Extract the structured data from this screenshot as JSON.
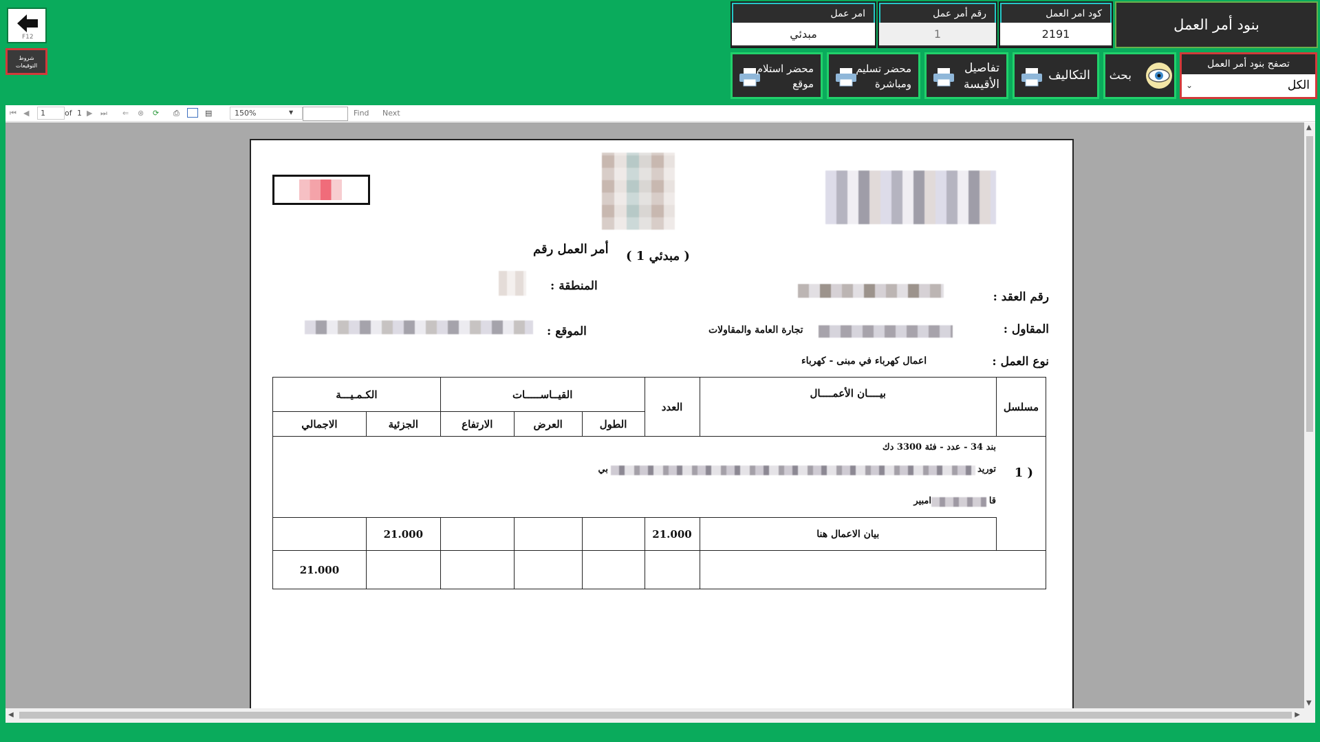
{
  "header": {
    "title": "بنود أمر العمل",
    "fields": [
      {
        "label": "كود امر العمل",
        "value": "2191"
      },
      {
        "label": "رقم أمر عمل",
        "value": "1"
      },
      {
        "label": "امر عمل",
        "value": "مبدئي"
      }
    ],
    "browse": {
      "label": "تصفح بنود أمر العمل",
      "value": "الكل"
    }
  },
  "left": {
    "back_hint": "F12",
    "signatures": "شروط التوقيعات"
  },
  "toolbar": {
    "search": "بحث",
    "costs": "التكاليف",
    "measure_1": "تفاصيل",
    "measure_2": "الأقيسة",
    "handover_1": "محضر تسليم",
    "handover_2": "ومباشرة",
    "receipt_1": "محضر استلام",
    "receipt_2": "موقع"
  },
  "viewer": {
    "page": "1",
    "of": "of",
    "total": "1",
    "zoom": "150%",
    "find": "Find",
    "next": "Next"
  },
  "report": {
    "heading": "أمر العمل رقم",
    "heading_value": "( مبدئي 1 )",
    "contract_label": "رقم العقد :",
    "region_label": "المنطقة :",
    "contractor_label": "المقاول :",
    "contractor_value": "تجارة العامة والمقاولات",
    "site_label": "الموقع :",
    "work_type_label": "نوع العمل :",
    "work_type_value": "اعمال كهرباء في مبنى - كهرباء",
    "columns": {
      "serial": "مسلسل",
      "description": "بيــــان الأعمــــال",
      "count": "العدد",
      "measurements": "القيــاســـــات",
      "quantity": "الكـمـيـــة",
      "length": "الطول",
      "width": "العرض",
      "height": "الارتفاع",
      "partial": "الجزئية",
      "total": "الاجمالي"
    },
    "item": {
      "serial": "1 )",
      "line1": "بند 34 - عدد - فئة 3300 دك",
      "line2_start": "توريد",
      "line2_end": "بي",
      "line3_end": "امبير",
      "line3_start": "قا",
      "row_label": "بيان الاعمال هنا",
      "count": "21.000",
      "partial": "21.000",
      "total": "21.000"
    }
  }
}
